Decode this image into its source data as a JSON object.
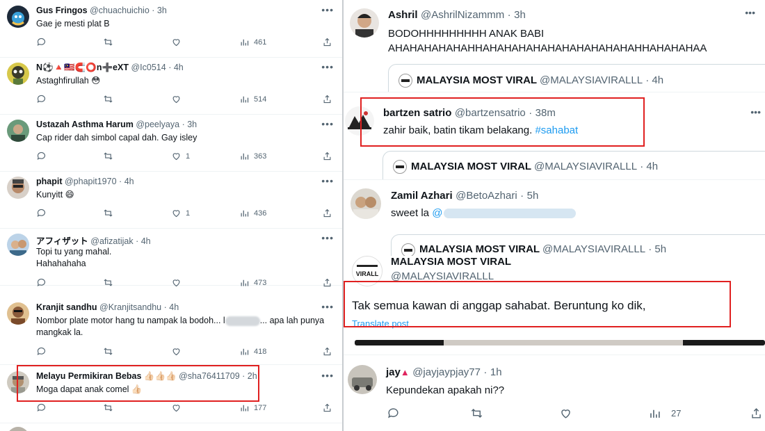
{
  "left_tweets": [
    {
      "name": "Gus Fringos",
      "handle": "@chuachuichio",
      "time": "3h",
      "text": "Gae je mesti plat B",
      "likes": "",
      "views": "461"
    },
    {
      "name": "N⚽🔺🇲🇾🧲⭕n➕eXT",
      "handle": "@Ic0514",
      "time": "4h",
      "text": "Astaghfirullah 😳",
      "likes": "",
      "views": "514"
    },
    {
      "name": "Ustazah Asthma Harum",
      "handle": "@peelyaya",
      "time": "3h",
      "text": "Cap rider dah simbol capal dah. Gay isley",
      "likes": "1",
      "views": "363"
    },
    {
      "name": "phapit",
      "handle": "@phapit1970",
      "time": "4h",
      "text": "Kunyitt 😄",
      "likes": "1",
      "views": "436"
    },
    {
      "name": "アフィザット",
      "handle": "@afizatijak",
      "time": "4h",
      "text": "Topi tu yang mahal.",
      "text2": "Hahahahaha",
      "likes": "",
      "views": "473"
    },
    {
      "name": "Kranjit sandhu",
      "handle": "@Kranjitsandhu",
      "time": "4h",
      "text": "Nombor plate motor hang tu nampak la bodoh... l",
      "text_after": "... apa lah punya",
      "text2": "mangkak la.",
      "likes": "",
      "views": "418"
    },
    {
      "name": "Melayu Permikiran Bebas 👍🏻👍🏻👍🏻",
      "handle": "@sha76411709",
      "time": "2h",
      "text": "Moga dapat anak comel 👍🏻",
      "likes": "",
      "views": "177"
    }
  ],
  "sep": "·",
  "right": {
    "ashril": {
      "name": "Ashril",
      "handle": "@AshrilNizammm",
      "time": "3h",
      "line1": "BODOHHHHHHHHH ANAK BABI",
      "line2": "AHAHAHAHAHAHHAHAHAHAHAHAHAHAHAHAHAHHAHAHAHAA"
    },
    "quote_name": "MALAYSIA MOST VIRAL",
    "quote_handle": "@MALAYSIAVIRALLL",
    "quote1_time": "4h",
    "quote2_time": "4h",
    "quote3_time": "5h",
    "bartzen": {
      "name": "bartzen satrio",
      "handle": "@bartzensatrio",
      "time": "38m",
      "text": "zahir baik, batin tikam belakang. ",
      "hashtag": "#sahabat"
    },
    "zamil": {
      "name": "Zamil Azhari",
      "handle": "@BetoAzhari",
      "time": "5h",
      "text": "sweet la ",
      "mention": "@"
    },
    "mmv": {
      "name": "MALAYSIA MOST VIRAL",
      "handle": "@MALAYSIAVIRALLL",
      "text": "Tak semua kawan di anggap sahabat. Beruntung ko dik,",
      "translate": "Translate post",
      "logo_text": "VIRALL"
    },
    "jay": {
      "name": "jay",
      "handle": "@jayjaypjay77",
      "time": "1h",
      "text": "Kepundekan apakah ni??",
      "views": "27"
    }
  },
  "colors": {
    "highlight_box": "#e02020",
    "link": "#1d9bf0",
    "meta": "#536471"
  }
}
